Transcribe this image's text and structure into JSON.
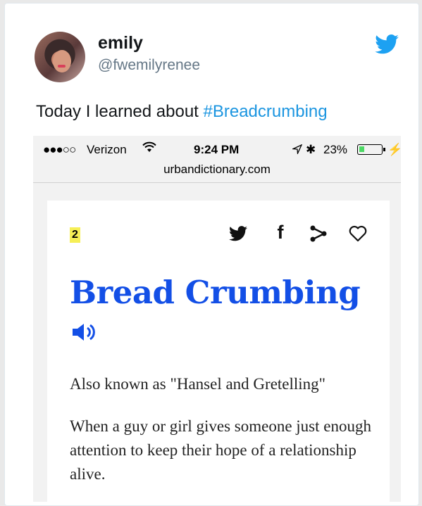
{
  "tweet": {
    "display_name": "emily",
    "handle": "@fwemilyrenee",
    "text_prefix": "Today I learned about ",
    "hashtag": "#Breadcrumbing",
    "brand_color": "#1da1f2",
    "icons": {
      "avatar": "avatar",
      "brand": "twitter-bird-icon"
    }
  },
  "phone": {
    "status_bar": {
      "signal": "●●●○○",
      "carrier": "Verizon",
      "time": "9:24 PM",
      "battery_percent": "23%",
      "bluetooth": "✱",
      "bolt": "⚡",
      "battery_level": 0.23,
      "battery_color": "#4cd964"
    },
    "url": "urbandictionary.com"
  },
  "definition": {
    "rank": "2",
    "share_icons": [
      "twitter-icon",
      "facebook-icon",
      "share-icon",
      "heart-icon"
    ],
    "facebook_glyph": "f",
    "word": "Bread Crumbing",
    "word_color": "#134fe6",
    "meaning": [
      "Also known as \"Hansel and Gretelling\"",
      "When a guy or girl gives someone just enough attention to keep their hope of a relationship alive."
    ]
  }
}
